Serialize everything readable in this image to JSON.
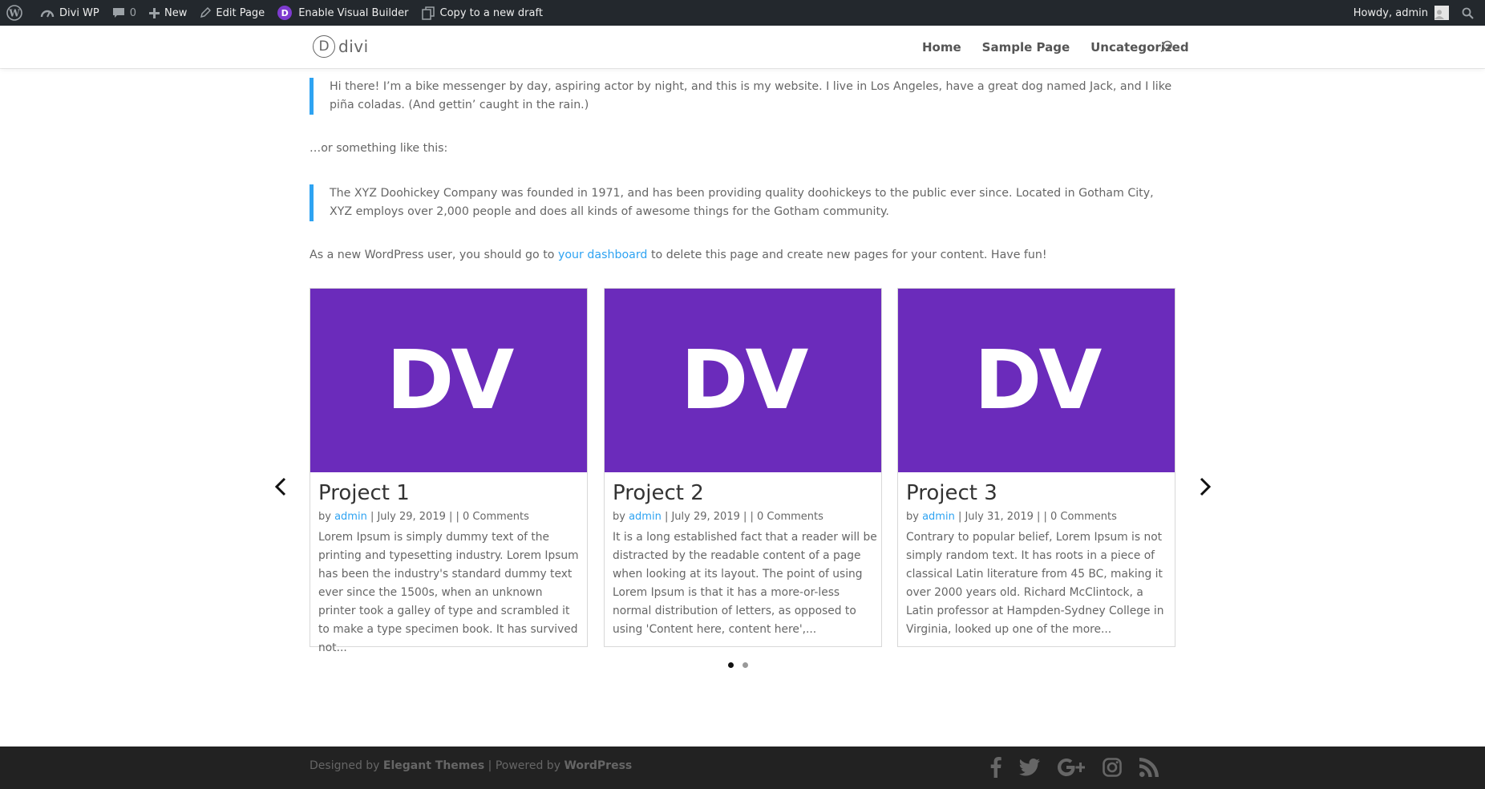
{
  "adminbar": {
    "site_name": "Divi WP",
    "comments_count": "0",
    "new_label": "New",
    "edit_label": "Edit Page",
    "visual_builder_label": "Enable Visual Builder",
    "copy_draft_label": "Copy to a new draft",
    "howdy_label": "Howdy, admin",
    "divi_badge": "D"
  },
  "header": {
    "logo_letter": "D",
    "logo_text": "divi",
    "nav": [
      "Home",
      "Sample Page",
      "Uncategorized"
    ]
  },
  "content": {
    "quote1": "Hi there! I’m a bike messenger by day, aspiring actor by night, and this is my website. I live in Los Angeles, have a great dog named Jack, and I like piña coladas. (And gettin’ caught in the rain.)",
    "para1": "…or something like this:",
    "quote2": "The XYZ Doohickey Company was founded in 1971, and has been providing quality doohickeys to the public ever since. Located in Gotham City, XYZ employs over 2,000 people and does all kinds of awesome things for the Gotham community.",
    "para2_before": "As a new WordPress user, you should go to ",
    "para2_link": "your dashboard",
    "para2_after": " to delete this page and create new pages for your content. Have fun!"
  },
  "projects": [
    {
      "image_text": "DV",
      "title": "Project 1",
      "by": "by ",
      "author": "admin",
      "meta_rest": " | July 29, 2019 | | 0 Comments",
      "excerpt": "Lorem Ipsum is simply dummy text of the printing and typesetting industry. Lorem Ipsum has been the industry's standard dummy text ever since the 1500s, when an unknown printer took a galley of type and scrambled it to make a type specimen book. It has survived not..."
    },
    {
      "image_text": "DV",
      "title": "Project 2",
      "by": "by ",
      "author": "admin",
      "meta_rest": " | July 29, 2019 | | 0 Comments",
      "excerpt": "It is a long established fact that a reader will be distracted by the readable content of a page when looking at its layout. The point of using Lorem Ipsum is that it has a more-or-less normal distribution of letters, as opposed to using 'Content here, content here',..."
    },
    {
      "image_text": "DV",
      "title": "Project 3",
      "by": "by ",
      "author": "admin",
      "meta_rest": " | July 31, 2019 | | 0 Comments",
      "excerpt": "Contrary to popular belief, Lorem Ipsum is not simply random text. It has roots in a piece of classical Latin literature from 45 BC, making it over 2000 years old. Richard McClintock, a Latin professor at Hampden-Sydney College in Virginia, looked up one of the more..."
    }
  ],
  "carousel": {
    "prev_icon": "chevron-left-icon",
    "next_icon": "chevron-right-icon",
    "dots": [
      true,
      false
    ]
  },
  "footer": {
    "designed_by": "Designed by ",
    "elegant": "Elegant Themes",
    "powered_by": " | Powered by ",
    "wordpress": "WordPress",
    "social": [
      "facebook-icon",
      "twitter-icon",
      "google-plus-icon",
      "instagram-icon",
      "rss-icon"
    ]
  },
  "colors": {
    "accent": "#2ea3f2",
    "project_image_bg": "#6b2bbb",
    "adminbar_bg": "#23282d",
    "footer_bg": "#222222"
  }
}
